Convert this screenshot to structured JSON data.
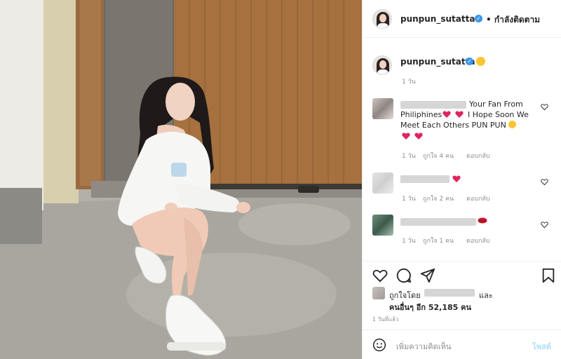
{
  "post": {
    "username": "punpun_sutatta",
    "follow_status": "• กำลังติดตาม",
    "caption_emoji": "squinting-face-emoji",
    "caption_time": "1 วัน"
  },
  "comments": [
    {
      "text_line1": "Your Fan From",
      "text_line2": "Philiphines",
      "text_line2b": "I Hope Soon We",
      "text_line3": "Meet Each Others PUN PUN",
      "time": "1 วัน",
      "likes": "ถูกใจ 4 คน",
      "reply": "ตอบกลับ"
    },
    {
      "time": "1 วัน",
      "likes": "ถูกใจ 2 คน",
      "reply": "ตอบกลับ"
    },
    {
      "time": "1 วัน",
      "likes": "ถูกใจ 1 คน",
      "reply": "ตอบกลับ"
    }
  ],
  "liked_by": {
    "prefix": "ถูกใจโดย",
    "and": "และ",
    "others": "คนอื่นๆ อีก 52,185 คน"
  },
  "post_time": "1 วันที่แล้ว",
  "add_comment": {
    "placeholder": "เพิ่มความคิดเห็น",
    "post_label": "โพสต์"
  },
  "colors": {
    "verified": "#3897f0",
    "post_button": "#b2dffc",
    "heart_red": "#e0245e"
  }
}
